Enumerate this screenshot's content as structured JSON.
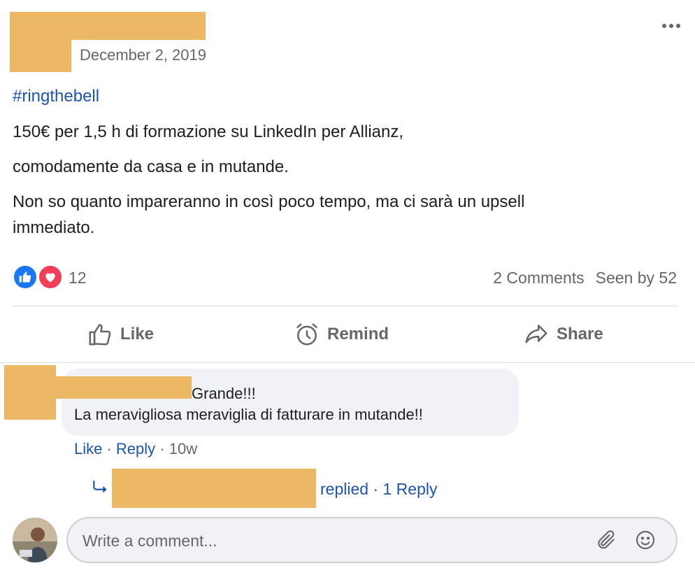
{
  "post": {
    "date": "December 2, 2019",
    "hashtag": "#ringthebell",
    "lines": [
      "150€ per 1,5 h di formazione su LinkedIn per Allianz,",
      "comodamente da casa e in mutande.",
      "Non so quanto impareranno in così poco tempo, ma ci sarà un upsell",
      "immediato."
    ]
  },
  "reactions": {
    "count": "12",
    "comments": "2 Comments",
    "seen": "Seen by 52"
  },
  "actions": {
    "like": "Like",
    "remind": "Remind",
    "share": "Share"
  },
  "comment": {
    "line1": "Grande!!!",
    "line2": "La meravigliosa meraviglia di fatturare in mutande!!",
    "like": "Like",
    "sep1": " · ",
    "reply": "Reply",
    "sep2": " · ",
    "time": "10w"
  },
  "reply_summary": {
    "replied": "replied",
    "sep": " · ",
    "link": "1 Reply"
  },
  "composer": {
    "placeholder": "Write a comment..."
  },
  "colors": {
    "accent": "#1d54b0",
    "redaction": "#ecb865",
    "like": "#1877f2",
    "love": "#f33e58"
  }
}
